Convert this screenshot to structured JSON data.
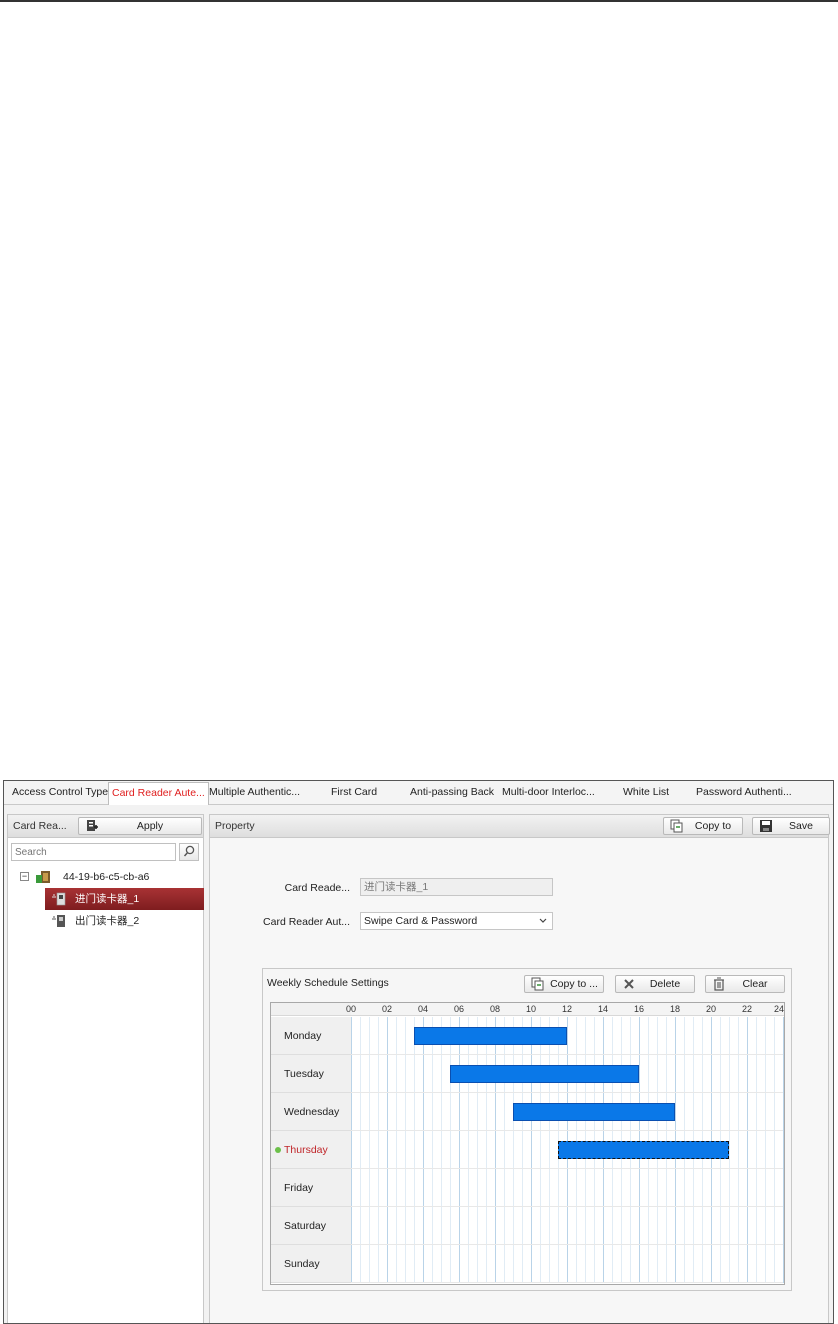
{
  "tabs": [
    {
      "label": "Access Control Type",
      "active": false
    },
    {
      "label": "Card Reader Aute...",
      "active": true
    },
    {
      "label": "Multiple Authentic...",
      "active": false
    },
    {
      "label": "First Card",
      "active": false
    },
    {
      "label": "Anti-passing Back",
      "active": false
    },
    {
      "label": "Multi-door Interloc...",
      "active": false
    },
    {
      "label": "White List",
      "active": false
    },
    {
      "label": "Password Authenti...",
      "active": false
    }
  ],
  "left_panel": {
    "title": "Card Rea...",
    "apply_label": "Apply",
    "search_placeholder": "Search",
    "tree": {
      "device": "44-19-b6-c5-cb-a6",
      "collapse_glyph": "−",
      "readers": [
        {
          "label": "进门读卡器_1",
          "selected": true
        },
        {
          "label": "出门读卡器_2",
          "selected": false
        }
      ]
    }
  },
  "property": {
    "title": "Property",
    "copy_to_label": "Copy to",
    "save_label": "Save",
    "card_reader_label": "Card Reade...",
    "card_reader_value": "进门读卡器_1",
    "auth_label": "Card Reader Aut...",
    "auth_value": "Swipe Card & Password"
  },
  "schedule": {
    "title": "Weekly Schedule Settings",
    "copy_label": "Copy to ...",
    "delete_label": "Delete",
    "clear_label": "Clear",
    "hours": [
      "00",
      "02",
      "04",
      "06",
      "08",
      "10",
      "12",
      "14",
      "16",
      "18",
      "20",
      "22",
      "24"
    ],
    "days": [
      {
        "label": "Monday",
        "start": 3.5,
        "end": 12.0,
        "selected": false
      },
      {
        "label": "Tuesday",
        "start": 5.5,
        "end": 16.0,
        "selected": false
      },
      {
        "label": "Wednesday",
        "start": 9.0,
        "end": 18.0,
        "selected": false
      },
      {
        "label": "Thursday",
        "start": 11.5,
        "end": 21.0,
        "selected": true
      },
      {
        "label": "Friday",
        "start": null,
        "end": null,
        "selected": false
      },
      {
        "label": "Saturday",
        "start": null,
        "end": null,
        "selected": false
      },
      {
        "label": "Sunday",
        "start": null,
        "end": null,
        "selected": false
      }
    ],
    "bar_color": "#0a78e8",
    "selected_day_color": "#c0262a"
  }
}
